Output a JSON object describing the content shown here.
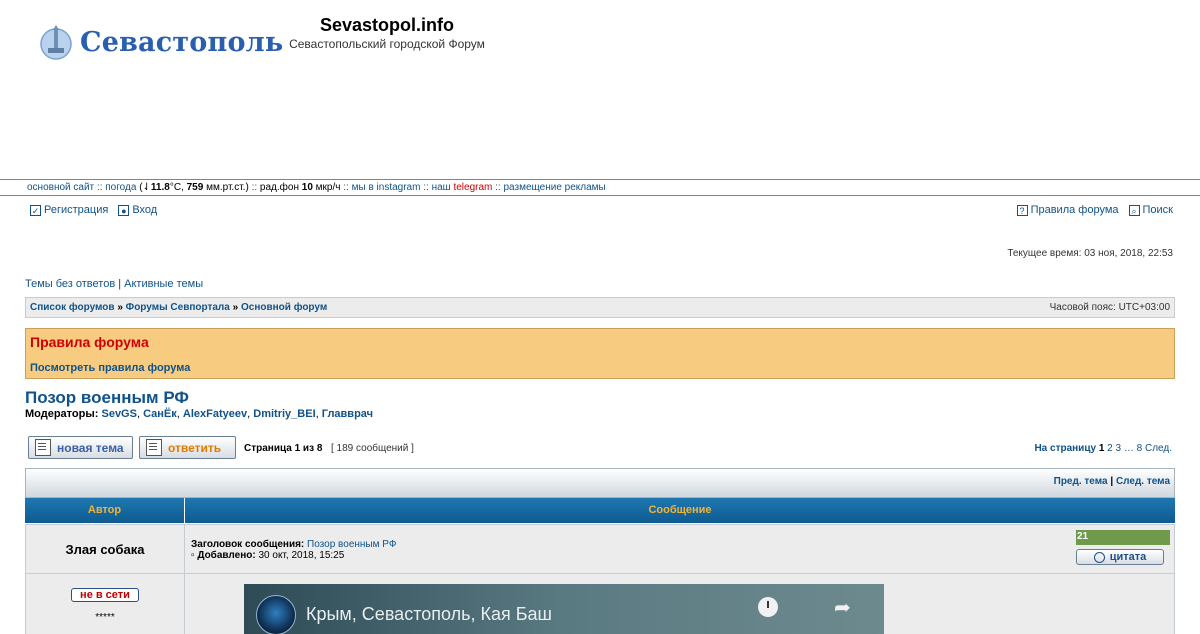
{
  "header": {
    "logo_text": "Севастополь",
    "site_title": "Sevastopol.info",
    "site_subtitle": "Севастопольский городской Форум"
  },
  "topbar": {
    "main_site": "основной сайт",
    "sep": "::",
    "weather": "погода",
    "temp": "11.8",
    "temp_unit": "°C,",
    "pressure": "759",
    "pressure_unit": "мм.рт.ст.)",
    "radiation_label": "рад.фон",
    "radiation": "10",
    "radiation_unit": "мкр/ч",
    "instagram": "мы в instagram",
    "our": "наш",
    "telegram": "telegram",
    "ads": "размещение рекламы"
  },
  "nav": {
    "register": "Регистрация",
    "login": "Вход",
    "rules": "Правила форума",
    "search": "Поиск"
  },
  "current_time": "Текущее время: 03 ноя, 2018, 22:53",
  "quicklinks": {
    "unanswered": "Темы без ответов",
    "divider": "|",
    "active": "Активные темы"
  },
  "breadcrumb": {
    "items": [
      "Список форумов",
      "Форумы Севпортала",
      "Основной форум"
    ],
    "separator": "»",
    "timezone": "Часовой пояс: UTC+03:00"
  },
  "rules_box": {
    "title": "Правила форума",
    "link": "Посмотреть правила форума"
  },
  "topic": {
    "title": "Позор военным РФ",
    "moderators_label": "Модераторы:",
    "moderators": [
      "SevGS",
      "СанЁк",
      "AlexFatyeev",
      "Dmitriy_BEI",
      "Главврач"
    ]
  },
  "actions": {
    "new_topic": "новая тема",
    "reply": "ответить",
    "page_info": "Страница 1 из 8",
    "message_count": "[ 189 сообщений ]"
  },
  "pagination": {
    "label": "На страницу",
    "current": "1",
    "pages": [
      "2",
      "3"
    ],
    "ellipsis": "…",
    "last": "8",
    "next": "След."
  },
  "thread_nav": {
    "prev": "Пред. тема",
    "divider": "|",
    "next": "След. тема"
  },
  "columns": {
    "author": "Автор",
    "message": "Сообщение"
  },
  "post": {
    "author": "Злая собака",
    "subject_label": "Заголовок сообщения:",
    "subject": "Позор военным РФ",
    "added_label": "Добавлено:",
    "added": "30 окт, 2018, 15:25",
    "rating": "21",
    "quote_label": "цитата",
    "status": "не в сети",
    "rank": "*****",
    "video_title": "Крым, Севастополь, Кая Баш"
  },
  "colors": {
    "link": "#105289",
    "rules_bg": "#f8cc80",
    "rules_title": "#d00000",
    "header_bar": "#0d5b91",
    "header_text": "#f5b335",
    "rating_bg": "#6f9a4c"
  }
}
